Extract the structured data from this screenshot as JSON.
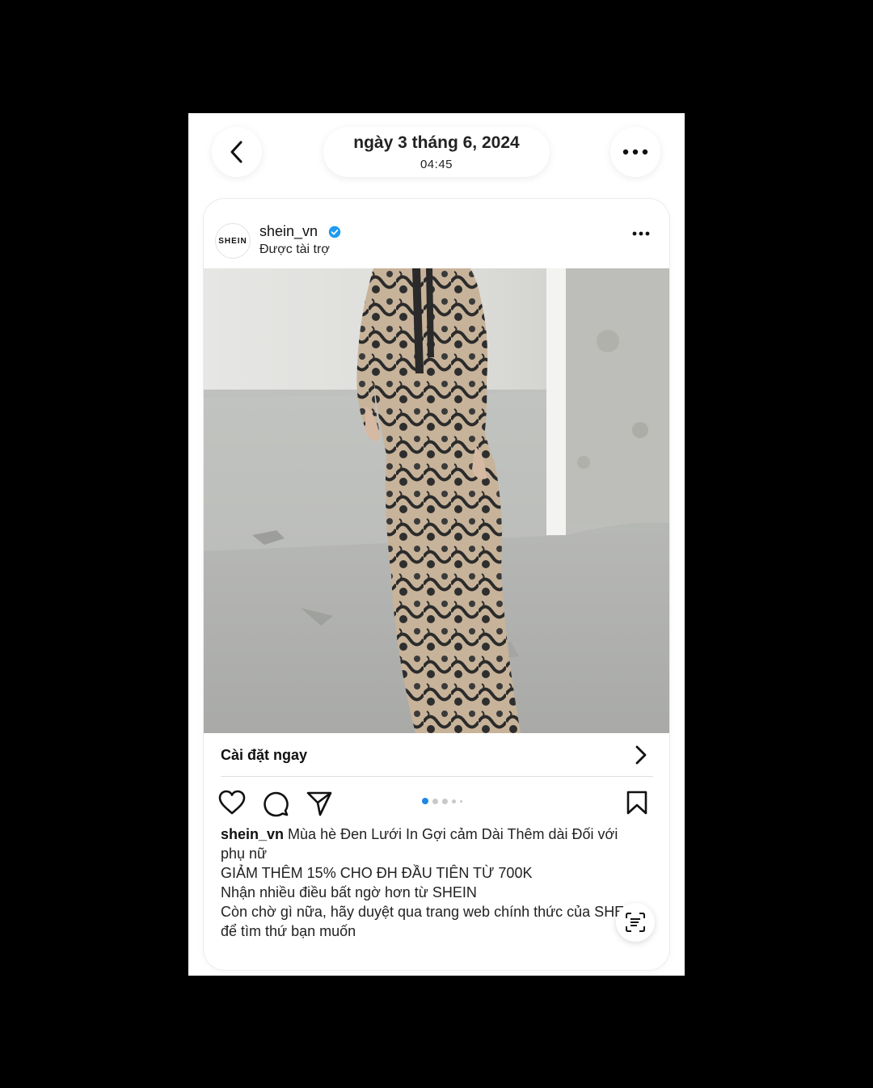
{
  "header": {
    "date": "ngày 3 tháng 6, 2024",
    "time": "04:45"
  },
  "post": {
    "avatar_text": "SHEIN",
    "username": "shein_vn",
    "sponsored": "Được tài trợ",
    "cta_label": "Cài đặt ngay",
    "carousel": {
      "total": 5,
      "current": 1
    },
    "caption": {
      "username": "shein_vn",
      "line1": "Mùa hè Đen Lưới In Gợi cảm Dài Thêm dài Đối với phụ nữ",
      "line2": "GIẢM THÊM 15% CHO ĐH ĐẦU TIÊN TỪ 700K",
      "line3": "Nhận nhiều điều bất ngờ hơn từ SHEIN",
      "line4": "Còn chờ gì nữa, hãy duyệt qua trang web chính thức của SHEIN để tìm thứ bạn muốn"
    }
  },
  "icons": {
    "back": "chevron-left-icon",
    "more": "more-horizontal-icon",
    "verified": "verified-badge-icon",
    "like": "heart-icon",
    "comment": "comment-icon",
    "share": "send-icon",
    "save": "bookmark-icon",
    "scan": "text-scan-icon"
  },
  "colors": {
    "background": "#000000",
    "verified": "#1d9bf0",
    "carousel_active": "#1e88e5"
  }
}
